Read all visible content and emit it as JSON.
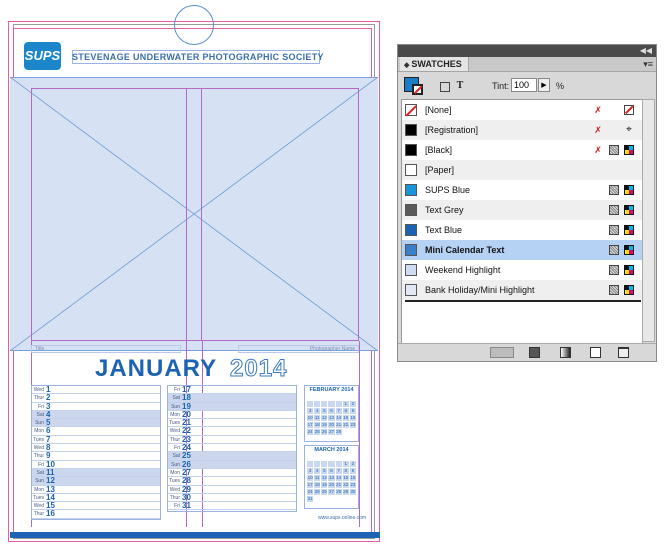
{
  "document": {
    "society_name": "STEVENAGE UNDERWATER PHOTOGRAPHIC SOCIETY",
    "logo_text": "SUPS",
    "title_field_label": "Title",
    "photographer_field_label": "Photographer Name",
    "month": "JANUARY",
    "year": "2014",
    "website": "www.sups.online.com",
    "days_col1": [
      {
        "dn": "Wed",
        "d": "1",
        "hl": false
      },
      {
        "dn": "Thur",
        "d": "2",
        "hl": false
      },
      {
        "dn": "Fri",
        "d": "3",
        "hl": false
      },
      {
        "dn": "Sat",
        "d": "4",
        "hl": true
      },
      {
        "dn": "Sun",
        "d": "5",
        "hl": true
      },
      {
        "dn": "Mon",
        "d": "6",
        "hl": false
      },
      {
        "dn": "Tues",
        "d": "7",
        "hl": false
      },
      {
        "dn": "Wed",
        "d": "8",
        "hl": false
      },
      {
        "dn": "Thur",
        "d": "9",
        "hl": false
      },
      {
        "dn": "Fri",
        "d": "10",
        "hl": false
      },
      {
        "dn": "Sat",
        "d": "11",
        "hl": true
      },
      {
        "dn": "Sun",
        "d": "12",
        "hl": true
      },
      {
        "dn": "Mon",
        "d": "13",
        "hl": false
      },
      {
        "dn": "Tues",
        "d": "14",
        "hl": false
      },
      {
        "dn": "Wed",
        "d": "15",
        "hl": false
      },
      {
        "dn": "Thur",
        "d": "16",
        "hl": false
      }
    ],
    "days_col2": [
      {
        "dn": "Fri",
        "d": "17",
        "hl": false
      },
      {
        "dn": "Sat",
        "d": "18",
        "hl": true
      },
      {
        "dn": "Sun",
        "d": "19",
        "hl": true
      },
      {
        "dn": "Mon",
        "d": "20",
        "hl": false
      },
      {
        "dn": "Tues",
        "d": "21",
        "hl": false
      },
      {
        "dn": "Wed",
        "d": "22",
        "hl": false
      },
      {
        "dn": "Thur",
        "d": "23",
        "hl": false
      },
      {
        "dn": "Fri",
        "d": "24",
        "hl": false
      },
      {
        "dn": "Sat",
        "d": "25",
        "hl": true
      },
      {
        "dn": "Sun",
        "d": "26",
        "hl": true
      },
      {
        "dn": "Mon",
        "d": "27",
        "hl": false
      },
      {
        "dn": "Tues",
        "d": "28",
        "hl": false
      },
      {
        "dn": "Wed",
        "d": "29",
        "hl": false
      },
      {
        "dn": "Thur",
        "d": "30",
        "hl": false
      },
      {
        "dn": "Fri",
        "d": "31",
        "hl": false
      }
    ],
    "mini_cal_1_title": "FEBRUARY 2014",
    "mini_cal_1_days": [
      "",
      "",
      "",
      "",
      "",
      "1",
      "2",
      "3",
      "4",
      "5",
      "6",
      "7",
      "8",
      "9",
      "10",
      "11",
      "12",
      "13",
      "14",
      "15",
      "16",
      "17",
      "18",
      "19",
      "20",
      "21",
      "22",
      "23",
      "24",
      "25",
      "26",
      "27",
      "28"
    ],
    "mini_cal_2_title": "MARCH 2014",
    "mini_cal_2_days": [
      "",
      "",
      "",
      "",
      "",
      "1",
      "2",
      "3",
      "4",
      "5",
      "6",
      "7",
      "8",
      "9",
      "10",
      "11",
      "12",
      "13",
      "14",
      "15",
      "16",
      "17",
      "18",
      "19",
      "20",
      "21",
      "22",
      "23",
      "24",
      "25",
      "26",
      "27",
      "28",
      "29",
      "30",
      "31"
    ]
  },
  "panel": {
    "title": "SWATCHES",
    "tint_label": "Tint:",
    "tint_value": "100",
    "tint_unit": "%",
    "swatches": [
      {
        "name": "[None]",
        "color": "none",
        "icons": [
          "noedit",
          "none"
        ]
      },
      {
        "name": "[Registration]",
        "color": "#000000",
        "icons": [
          "noedit",
          "reg"
        ]
      },
      {
        "name": "[Black]",
        "color": "#000000",
        "icons": [
          "noedit",
          "process",
          "cmyk"
        ]
      },
      {
        "name": "[Paper]",
        "color": "#ffffff",
        "icons": []
      },
      {
        "name": "SUPS Blue",
        "color": "#1a96d8",
        "icons": [
          "process",
          "cmyk"
        ]
      },
      {
        "name": "Text Grey",
        "color": "#5a5a5a",
        "icons": [
          "process",
          "cmyk"
        ]
      },
      {
        "name": "Text Blue",
        "color": "#1c64b3",
        "icons": [
          "process",
          "cmyk"
        ]
      },
      {
        "name": "Mini Calendar Text",
        "color": "#3b7fc9",
        "icons": [
          "process",
          "cmyk"
        ],
        "selected": true
      },
      {
        "name": "Weekend Highlight",
        "color": "#d0dcf1",
        "icons": [
          "process",
          "cmyk"
        ]
      },
      {
        "name": "Bank Holiday/Mini Highlight",
        "color": "#e1e8f4",
        "icons": [
          "process",
          "cmyk"
        ]
      }
    ]
  }
}
